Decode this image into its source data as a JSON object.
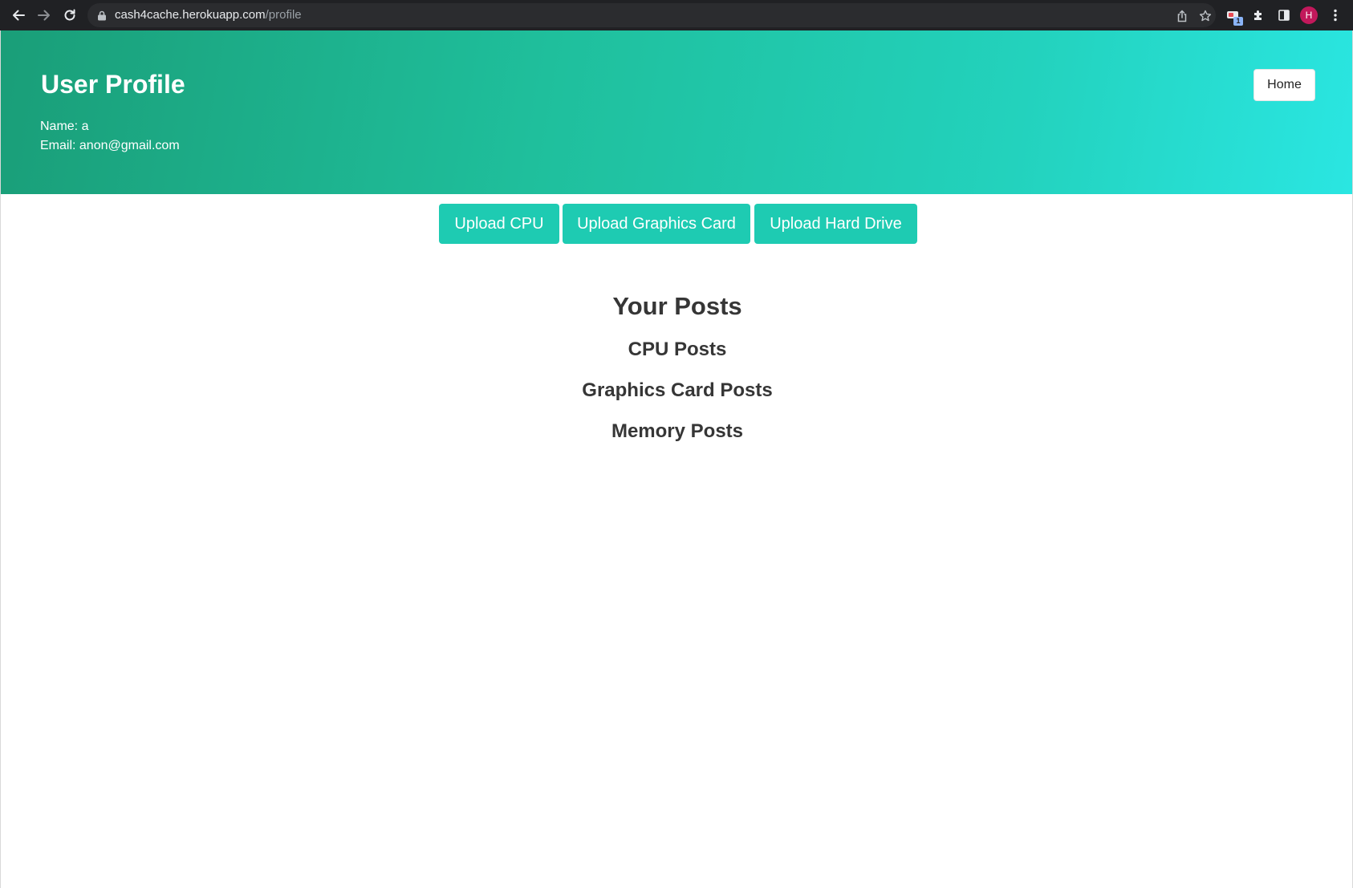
{
  "browser": {
    "url_host": "cash4cache.herokuapp.com",
    "url_path": "/profile",
    "extension_badge": "1",
    "profile_initial": "H"
  },
  "header": {
    "title": "User Profile",
    "name_line": "Name: a",
    "email_line": "Email: anon@gmail.com",
    "home_label": "Home",
    "gradient_start": "#1a9e78",
    "gradient_end": "#2ae6e2"
  },
  "actions": {
    "upload_cpu": "Upload CPU",
    "upload_gpu": "Upload Graphics Card",
    "upload_hdd": "Upload Hard Drive",
    "accent": "#1ecbb2"
  },
  "posts": {
    "title": "Your Posts",
    "sections": [
      "CPU Posts",
      "Graphics Card Posts",
      "Memory Posts"
    ]
  }
}
